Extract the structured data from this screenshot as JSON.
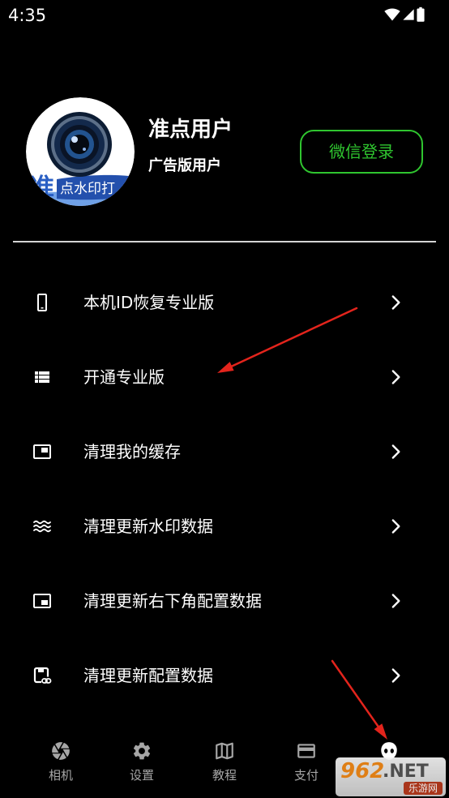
{
  "status_bar": {
    "time": "4:35",
    "icons": [
      "wifi-icon",
      "cell-signal-icon",
      "battery-icon"
    ]
  },
  "profile": {
    "avatar_logo": {
      "large_char": "准",
      "band_text": "点水印打"
    },
    "name": "准点用户",
    "account_type": "广告版用户",
    "login_button": "微信登录"
  },
  "menu": [
    {
      "icon": "phone-icon",
      "label": "本机ID恢复专业版"
    },
    {
      "icon": "list-icon",
      "label": "开通专业版"
    },
    {
      "icon": "picture-in-picture-icon",
      "label": "清理我的缓存"
    },
    {
      "icon": "waves-icon",
      "label": "清理更新水印数据"
    },
    {
      "icon": "picture-in-picture-bottom-right-icon",
      "label": "清理更新右下角配置数据"
    },
    {
      "icon": "config-link-icon",
      "label": "清理更新配置数据"
    }
  ],
  "bottom_nav": [
    {
      "icon": "camera-aperture-icon",
      "label": "相机"
    },
    {
      "icon": "gear-icon",
      "label": "设置"
    },
    {
      "icon": "map-icon",
      "label": "教程"
    },
    {
      "icon": "credit-card-icon",
      "label": "支付"
    },
    {
      "icon": "profile-face-icon",
      "active": true
    }
  ],
  "watermark": {
    "brand": "962",
    "suffix": ".NET",
    "site": "乐游网"
  },
  "colors": {
    "background": "#000000",
    "text": "#ffffff",
    "accent_green": "#2fc52f",
    "nav_inactive": "#a6a6a6",
    "nav_active": "#ffffff",
    "annotation_arrow": "#e3241c"
  }
}
